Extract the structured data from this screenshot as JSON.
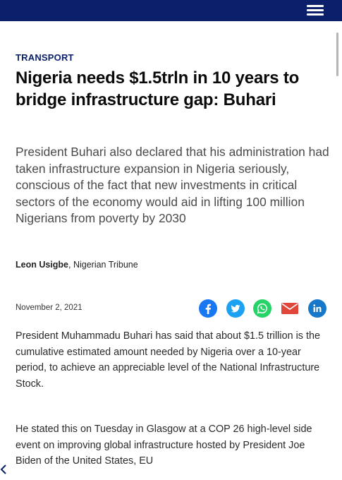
{
  "article": {
    "category": "TRANSPORT",
    "title": "Nigeria needs $1.5trln in 10 years to bridge infrastructure gap: Buhari",
    "summary": "President Buhari also declared that his administration had taken infrastructure expansion in Nigeria seriously, conscious of the fact that new investments in critical sectors of the economy would aid in lifting 100 million Nigerians from poverty by 2030",
    "author": "Leon Usigbe",
    "publication": ", Nigerian Tribune",
    "date": "November 2, 2021",
    "paragraphs": [
      "President Muhammadu Buhari has said that about $1.5 trillion is the cumulative estimated amount needed by Nigeria over a 10-year period, to achieve an appreciable level of the National Infrastructure Stock.",
      "He stated this on Tuesday in Glasgow at a COP 26 high-level side event on improving global infrastructure hosted by President Joe Biden of the United States, EU"
    ]
  },
  "share_icons": [
    {
      "name": "facebook-icon",
      "color": "#1877f2"
    },
    {
      "name": "twitter-icon",
      "color": "#1da1f2"
    },
    {
      "name": "whatsapp-icon",
      "color": "#25d366"
    },
    {
      "name": "email-icon",
      "color": "#e0463a"
    },
    {
      "name": "linkedin-icon",
      "color": "#1778c9"
    }
  ],
  "colors": {
    "navbar": "#0b1f6b",
    "category": "#0b1f6b"
  }
}
